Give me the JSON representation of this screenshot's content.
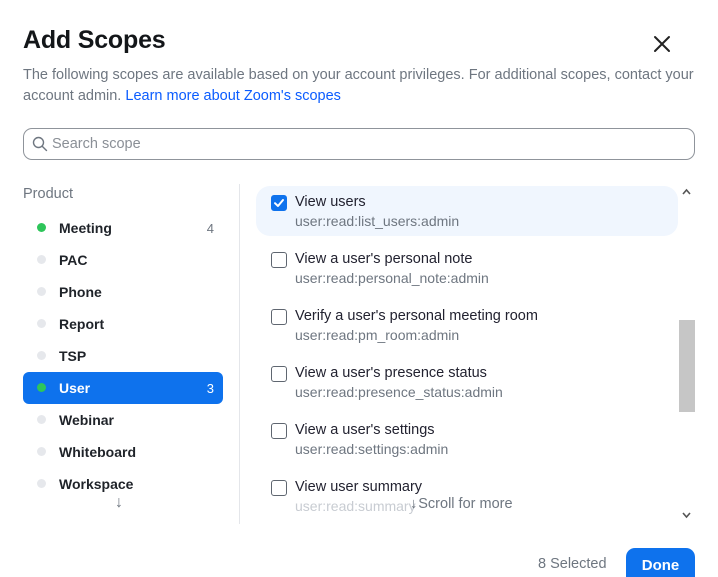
{
  "dialog": {
    "title": "Add Scopes",
    "description": "The following scopes are available based on your account privileges. For additional scopes, contact your account admin. ",
    "learn_more_link": "Learn more about Zoom's scopes",
    "close_icon": "close-icon"
  },
  "search": {
    "placeholder": "Search scope",
    "icon": "search-icon"
  },
  "products": {
    "label": "Product",
    "items": [
      {
        "name": "Meeting",
        "count": "4",
        "has_selection": true,
        "active": false
      },
      {
        "name": "PAC",
        "count": "",
        "has_selection": false,
        "active": false
      },
      {
        "name": "Phone",
        "count": "",
        "has_selection": false,
        "active": false
      },
      {
        "name": "Report",
        "count": "",
        "has_selection": false,
        "active": false
      },
      {
        "name": "TSP",
        "count": "",
        "has_selection": false,
        "active": false
      },
      {
        "name": "User",
        "count": "3",
        "has_selection": true,
        "active": true
      },
      {
        "name": "Webinar",
        "count": "",
        "has_selection": false,
        "active": false
      },
      {
        "name": "Whiteboard",
        "count": "",
        "has_selection": false,
        "active": false
      },
      {
        "name": "Workspace",
        "count": "",
        "has_selection": false,
        "active": false
      }
    ],
    "more_arrow": "↓"
  },
  "scopes": [
    {
      "name": "View users",
      "code": "user:read:list_users:admin",
      "checked": true
    },
    {
      "name": "View a user's personal note",
      "code": "user:read:personal_note:admin",
      "checked": false
    },
    {
      "name": "Verify a user's personal meeting room",
      "code": "user:read:pm_room:admin",
      "checked": false
    },
    {
      "name": "View a user's presence status",
      "code": "user:read:presence_status:admin",
      "checked": false
    },
    {
      "name": "View a user's settings",
      "code": "user:read:settings:admin",
      "checked": false
    },
    {
      "name": "View user summary",
      "code": "user:read:summary",
      "checked": false
    }
  ],
  "scroll_hint": {
    "arrow": "↓",
    "text": "Scroll for more"
  },
  "footer": {
    "selected_text": "8 Selected",
    "done_label": "Done"
  },
  "colors": {
    "accent": "#0e72ed",
    "active_dot": "#2ec55a",
    "inactive_dot": "#e6e8ec",
    "link": "#0b5cff"
  }
}
